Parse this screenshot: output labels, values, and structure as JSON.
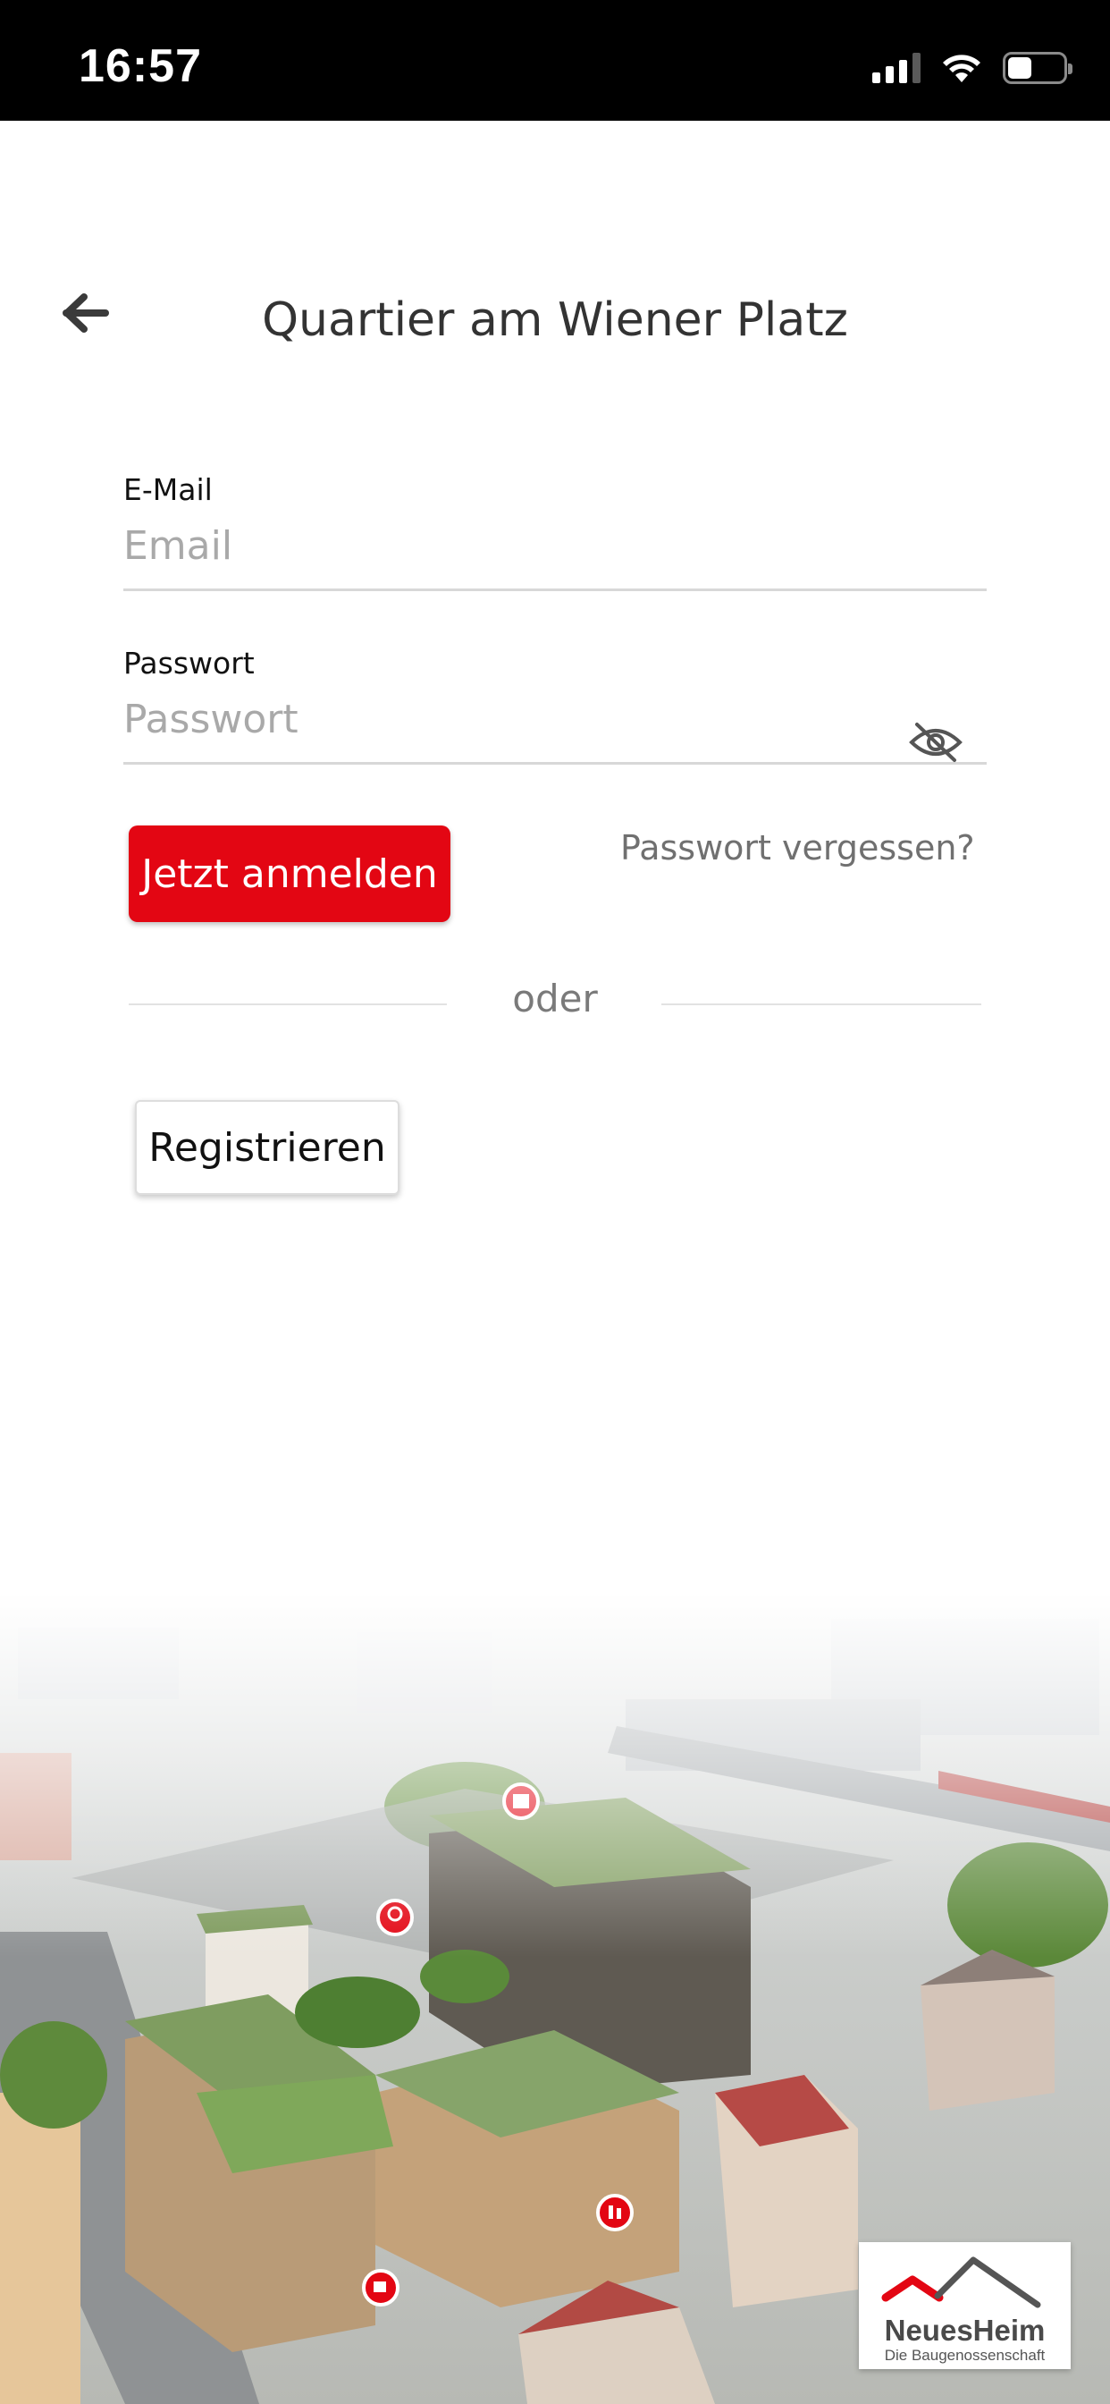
{
  "status_bar": {
    "time": "16:57",
    "icons": [
      "signal-icon",
      "wifi-icon",
      "battery-icon"
    ]
  },
  "header": {
    "back_icon": "arrow-left-icon",
    "title": "Quartier am Wiener Platz"
  },
  "form": {
    "email": {
      "label": "E-Mail",
      "placeholder": "Email",
      "value": ""
    },
    "password": {
      "label": "Passwort",
      "placeholder": "Passwort",
      "value": "",
      "toggle_icon": "eye-slash-icon"
    },
    "login_label": "Jetzt anmelden",
    "forgot_label": "Passwort vergessen?",
    "divider_label": "oder",
    "register_label": "Registrieren"
  },
  "illustration": {
    "map_pins": [
      "building-pin-icon",
      "tree-pin-icon",
      "family-pin-icon",
      "cafe-pin-icon"
    ]
  },
  "logo": {
    "name": "NeuesHeim",
    "subtitle": "Die Baugenossenschaft"
  },
  "colors": {
    "primary": "#e30613",
    "text_dark": "#333333",
    "placeholder": "#a9a9a9",
    "status_bar": "#000000"
  }
}
